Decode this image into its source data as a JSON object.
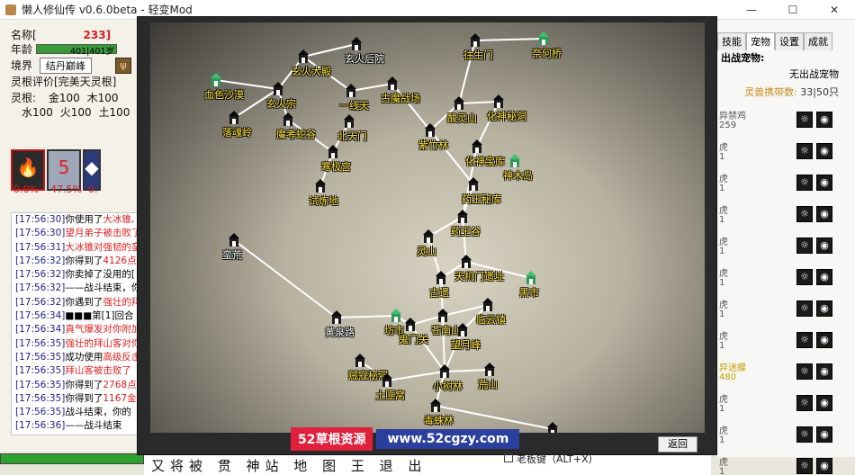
{
  "window": {
    "title": "懒人修仙传 v0.6.0beta - 轻变Mod",
    "controls": [
      "—",
      "☐",
      "✕"
    ]
  },
  "profile": {
    "name_label": "名称[",
    "name_value": "233]",
    "age_label": "年龄",
    "age_value": "401|401岁",
    "realm_label": "境界",
    "realm_value": "结丹巅峰",
    "root_eval": "灵根评价[完美天灵根]",
    "root_label": "灵根:",
    "root_metal": "金100",
    "root_wood": "木100",
    "root_water": "水100",
    "root_fire": "火100",
    "root_earth": "土100"
  },
  "skills": [
    {
      "pct": "0.0%",
      "glyph": "🔥"
    },
    {
      "pct": "47.5%",
      "glyph": "5"
    },
    {
      "pct": "0.",
      "glyph": "◆"
    }
  ],
  "log": [
    {
      "time": "[17:56:30]",
      "text": "你使用了",
      "hl": "大冰锥,"
    },
    {
      "time": "[17:56:30]",
      "text": "",
      "hl": "望月弟子被击败了"
    },
    {
      "time": "[17:56:31]",
      "text": "",
      "hl": "大冰锥对强韧的蛮"
    },
    {
      "time": "[17:56:32]",
      "text": "你得到了",
      "hl": "4126点"
    },
    {
      "time": "[17:56:32]",
      "text": "你卖掉了没用的[",
      "hl": ""
    },
    {
      "time": "[17:56:32]",
      "text": "——战斗结束，你的",
      "hl": ""
    },
    {
      "time": "[17:56:32]",
      "text": "你遇到了",
      "hl": "强壮的拜"
    },
    {
      "time": "[17:56:34]",
      "text": "■■■第[1]回合",
      "hl": ""
    },
    {
      "time": "[17:56:34]",
      "text": "",
      "hl": "真气爆发对你附加"
    },
    {
      "time": "[17:56:35]",
      "text": "",
      "hl": "强壮的拜山客对你"
    },
    {
      "time": "[17:56:35]",
      "text": "成功使用",
      "hl": "高级反击"
    },
    {
      "time": "[17:56:35]",
      "text": "",
      "hl": "拜山客被击败了"
    },
    {
      "time": "[17:56:35]",
      "text": "你得到了",
      "hl": "2768点"
    },
    {
      "time": "[17:56:35]",
      "text": "你得到了",
      "hl": "1167金币"
    },
    {
      "time": "[17:56:35]",
      "text": "战斗结束，你的",
      "hl": ""
    },
    {
      "time": "[17:56:36]",
      "text": "——战斗结束",
      "hl": ""
    }
  ],
  "pets": {
    "tabs": [
      "技能",
      "宠物",
      "设置",
      "成就"
    ],
    "active_tab": "宠物",
    "header": "出战宠物:",
    "none_text": "无出战宠物",
    "capacity_label": "灵兽携带数:",
    "capacity_value": "33|50只",
    "items": [
      {
        "name": "异禁鸡",
        "level": "259",
        "gold": false
      },
      {
        "name": "虎",
        "level": "1",
        "gold": false
      },
      {
        "name": "虎",
        "level": "1",
        "gold": false
      },
      {
        "name": "虎",
        "level": "1",
        "gold": false
      },
      {
        "name": "虎",
        "level": "1",
        "gold": false
      },
      {
        "name": "虎",
        "level": "1",
        "gold": false
      },
      {
        "name": "虎",
        "level": "1",
        "gold": false
      },
      {
        "name": "虎",
        "level": "1",
        "gold": false
      },
      {
        "name": "异迷蝶",
        "level": "480",
        "gold": true
      },
      {
        "name": "虎",
        "level": "1",
        "gold": false
      },
      {
        "name": "虎",
        "level": "1",
        "gold": false
      },
      {
        "name": "虎",
        "level": "1",
        "gold": false
      }
    ]
  },
  "map": {
    "nodes": [
      {
        "name": "玄火后院",
        "color": "white"
      },
      {
        "name": "往生门",
        "color": "yellow"
      },
      {
        "name": "奈何桥",
        "color": "yellow"
      },
      {
        "name": "血色沙漠",
        "color": "yellow"
      },
      {
        "name": "玄火大殿",
        "color": "yellow"
      },
      {
        "name": "玄火宗",
        "color": "yellow"
      },
      {
        "name": "一线天",
        "color": "yellow"
      },
      {
        "name": "古魔战场",
        "color": "yellow"
      },
      {
        "name": "酸灵山",
        "color": "yellow"
      },
      {
        "name": "化神秘洞",
        "color": "yellow"
      },
      {
        "name": "落魂岭",
        "color": "yellow"
      },
      {
        "name": "魔考蛇谷",
        "color": "yellow"
      },
      {
        "name": "北天门",
        "color": "yellow"
      },
      {
        "name": "紫竹林",
        "color": "yellow"
      },
      {
        "name": "寒极宫",
        "color": "yellow"
      },
      {
        "name": "化神宝库",
        "color": "yellow"
      },
      {
        "name": "神木岛",
        "color": "yellow"
      },
      {
        "name": "试炼地",
        "color": "yellow"
      },
      {
        "name": "药王秘库",
        "color": "yellow"
      },
      {
        "name": "药王谷",
        "color": "yellow"
      },
      {
        "name": "灵山",
        "color": "yellow"
      },
      {
        "name": "蛮荒",
        "color": "white"
      },
      {
        "name": "天机门遗址",
        "color": "yellow"
      },
      {
        "name": "古遗",
        "color": "yellow"
      },
      {
        "name": "黑市",
        "color": "yellow"
      },
      {
        "name": "黄泉路",
        "color": "white"
      },
      {
        "name": "坊市",
        "color": "yellow"
      },
      {
        "name": "鬼门关",
        "color": "yellow"
      },
      {
        "name": "苍南山",
        "color": "yellow"
      },
      {
        "name": "临云镇",
        "color": "yellow"
      },
      {
        "name": "望月峰",
        "color": "yellow"
      },
      {
        "name": "贼寇秘洞",
        "color": "yellow"
      },
      {
        "name": "小树林",
        "color": "yellow"
      },
      {
        "name": "荒山",
        "color": "yellow"
      },
      {
        "name": "土匪窝",
        "color": "yellow"
      },
      {
        "name": "毒蛛林",
        "color": "yellow"
      },
      {
        "name": "青龙宫",
        "color": "yellow"
      }
    ],
    "return_label": "返回",
    "watermark_red": "52草根资源",
    "watermark_blue": "www.52cgzy.com"
  },
  "footer": {
    "shortcut_label": "老板键（ALT+X）",
    "calligraphy": "又将被 贯 神站 地 图 王 退 出"
  }
}
